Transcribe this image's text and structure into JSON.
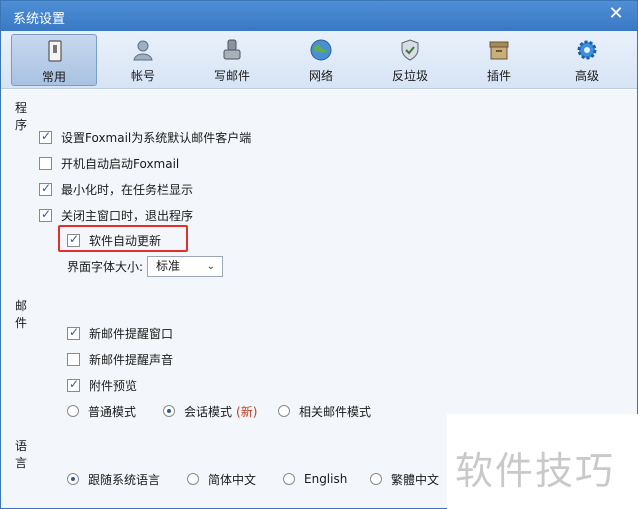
{
  "window": {
    "title": "系统设置"
  },
  "toolbar": {
    "items": [
      {
        "label": "常用",
        "icon": "general-settings-icon",
        "active": true
      },
      {
        "label": "帐号",
        "icon": "account-user-icon"
      },
      {
        "label": "写邮件",
        "icon": "compose-mail-icon"
      },
      {
        "label": "网络",
        "icon": "network-globe-icon"
      },
      {
        "label": "反垃圾",
        "icon": "anti-spam-shield-icon"
      },
      {
        "label": "插件",
        "icon": "plugin-box-icon"
      },
      {
        "label": "高级",
        "icon": "advanced-gear-icon"
      }
    ]
  },
  "program": {
    "title": "程序",
    "options": [
      {
        "label": "设置Foxmail为系统默认邮件客户端",
        "checked": true
      },
      {
        "label": "开机自动启动Foxmail",
        "checked": false
      },
      {
        "label": "最小化时，在任务栏显示",
        "checked": true
      },
      {
        "label": "关闭主窗口时，退出程序",
        "checked": true
      },
      {
        "label": "软件自动更新",
        "checked": true
      }
    ],
    "font_size_label": "界面字体大小:",
    "font_size_value": "标准"
  },
  "mail": {
    "title": "邮件",
    "options": [
      {
        "label": "新邮件提醒窗口",
        "checked": true
      },
      {
        "label": "新邮件提醒声音",
        "checked": false
      },
      {
        "label": "附件预览",
        "checked": true
      }
    ],
    "modes": [
      {
        "label": "普通模式",
        "selected": false
      },
      {
        "label": "会话模式",
        "tag": "(新)",
        "selected": true
      },
      {
        "label": "相关邮件模式",
        "selected": false
      }
    ]
  },
  "language": {
    "title": "语言",
    "options": [
      {
        "label": "跟随系统语言",
        "selected": true
      },
      {
        "label": "简体中文",
        "selected": false
      },
      {
        "label": "English",
        "selected": false
      },
      {
        "label": "繁體中文",
        "selected": false
      }
    ]
  },
  "watermark": {
    "text": "软件技巧"
  },
  "colors": {
    "accent": "#3a78c4",
    "highlight_box": "#e0312b",
    "new_tag": "#c23b22"
  }
}
